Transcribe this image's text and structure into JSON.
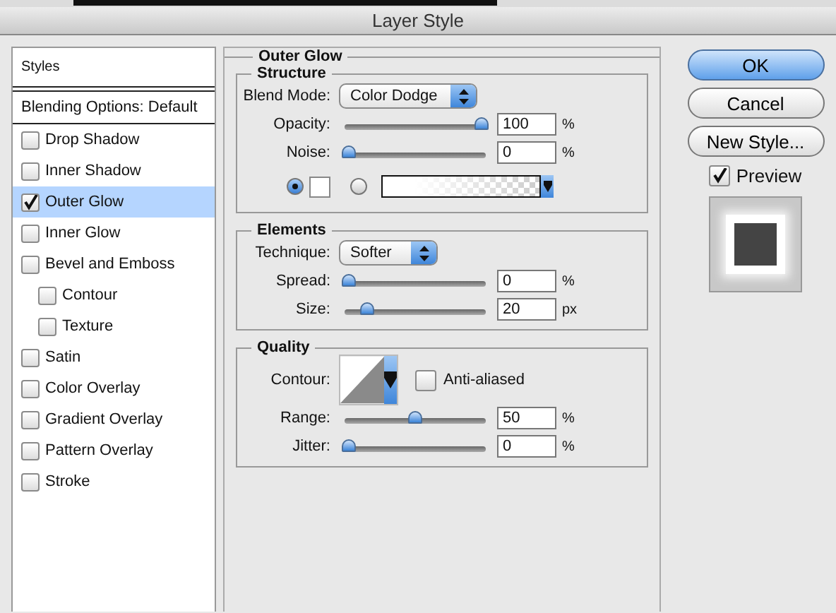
{
  "window": {
    "title": "Layer Style"
  },
  "sidebar": {
    "header": "Styles",
    "blending": "Blending Options: Default",
    "items": [
      {
        "label": "Drop Shadow",
        "checked": false,
        "selected": false
      },
      {
        "label": "Inner Shadow",
        "checked": false,
        "selected": false
      },
      {
        "label": "Outer Glow",
        "checked": true,
        "selected": true
      },
      {
        "label": "Inner Glow",
        "checked": false,
        "selected": false
      },
      {
        "label": "Bevel and Emboss",
        "checked": false,
        "selected": false,
        "children": [
          {
            "label": "Contour",
            "checked": false,
            "selected": false
          },
          {
            "label": "Texture",
            "checked": false,
            "selected": false
          }
        ]
      },
      {
        "label": "Satin",
        "checked": false,
        "selected": false
      },
      {
        "label": "Color Overlay",
        "checked": false,
        "selected": false
      },
      {
        "label": "Gradient Overlay",
        "checked": false,
        "selected": false
      },
      {
        "label": "Pattern Overlay",
        "checked": false,
        "selected": false
      },
      {
        "label": "Stroke",
        "checked": false,
        "selected": false
      }
    ]
  },
  "panel": {
    "title": "Outer Glow",
    "groups": [
      {
        "title": "Structure",
        "rows": [
          {
            "kind": "select",
            "label": "Blend Mode:",
            "value": "Color Dodge"
          },
          {
            "kind": "slider",
            "label": "Opacity:",
            "level": 1,
            "value": "100",
            "unit": "%"
          },
          {
            "kind": "slider",
            "label": "Noise:",
            "level": 0,
            "value": "0",
            "unit": "%"
          },
          {
            "kind": "fill",
            "options": [
              {
                "kind": "color",
                "selected": true
              },
              {
                "kind": "gradient",
                "selected": false
              }
            ]
          }
        ]
      },
      {
        "title": "Elements",
        "rows": [
          {
            "kind": "select",
            "label": "Technique:",
            "value": "Softer"
          },
          {
            "kind": "slider",
            "label": "Spread:",
            "level": 0,
            "value": "0",
            "unit": "%"
          },
          {
            "kind": "slider",
            "label": "Size:",
            "level": 0.14,
            "value": "20",
            "unit": "px"
          }
        ]
      },
      {
        "title": "Quality",
        "rows": [
          {
            "kind": "contour",
            "label": "Contour:",
            "checkbox": {
              "label": "Anti-aliased",
              "checked": false
            }
          },
          {
            "kind": "slider",
            "label": "Range:",
            "level": 0.5,
            "value": "50",
            "unit": "%"
          },
          {
            "kind": "slider",
            "label": "Jitter:",
            "level": 0,
            "value": "0",
            "unit": "%"
          }
        ]
      }
    ]
  },
  "buttons": [
    {
      "label": "OK",
      "default": true
    },
    {
      "label": "Cancel",
      "default": false
    },
    {
      "label": "New Style...",
      "default": false
    }
  ],
  "preview": {
    "label": "Preview",
    "checked": true
  }
}
